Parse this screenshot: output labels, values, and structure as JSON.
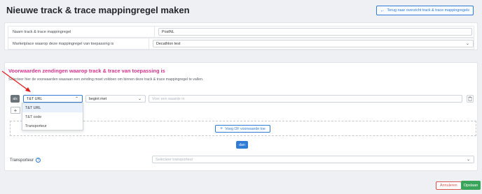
{
  "header": {
    "title": "Nieuwe track & trace mappingregel maken",
    "back_label": "Terug naar overzicht track & trace mappingregels"
  },
  "form": {
    "name_label": "Naam track & trace mappingregel",
    "name_value": "PostNL",
    "marketplace_label": "Marketplace waarop deze mappingregel van toepassing is",
    "marketplace_value": "Decathlon test"
  },
  "conditions": {
    "title": "Voorwaarden zendingen waarop track & trace van toepassing is",
    "description": "Selecteer hier de voorwaarden waaraan een zending moet voldoen om binnen deze track & trace mappingregel te vallen.",
    "als_label": "als",
    "field_value": "T&T URL",
    "operator_value": "begint met",
    "value_placeholder": "Voer een waarde in",
    "dropdown_options": [
      "T&T URL",
      "T&T code",
      "Transporteur"
    ],
    "add_condition_label": "Voeg OF voorwaarde toe",
    "then_label": "dan"
  },
  "carrier": {
    "label": "Transporteur",
    "placeholder": "Selecteer transporteur"
  },
  "footer": {
    "cancel_label": "Annuleren",
    "save_label": "Opslaan"
  },
  "colors": {
    "accent": "#2f7bd6",
    "section_title": "#d6338c",
    "save": "#3aa55a",
    "cancel": "#d9534f",
    "annotation_arrow": "#e02020"
  }
}
